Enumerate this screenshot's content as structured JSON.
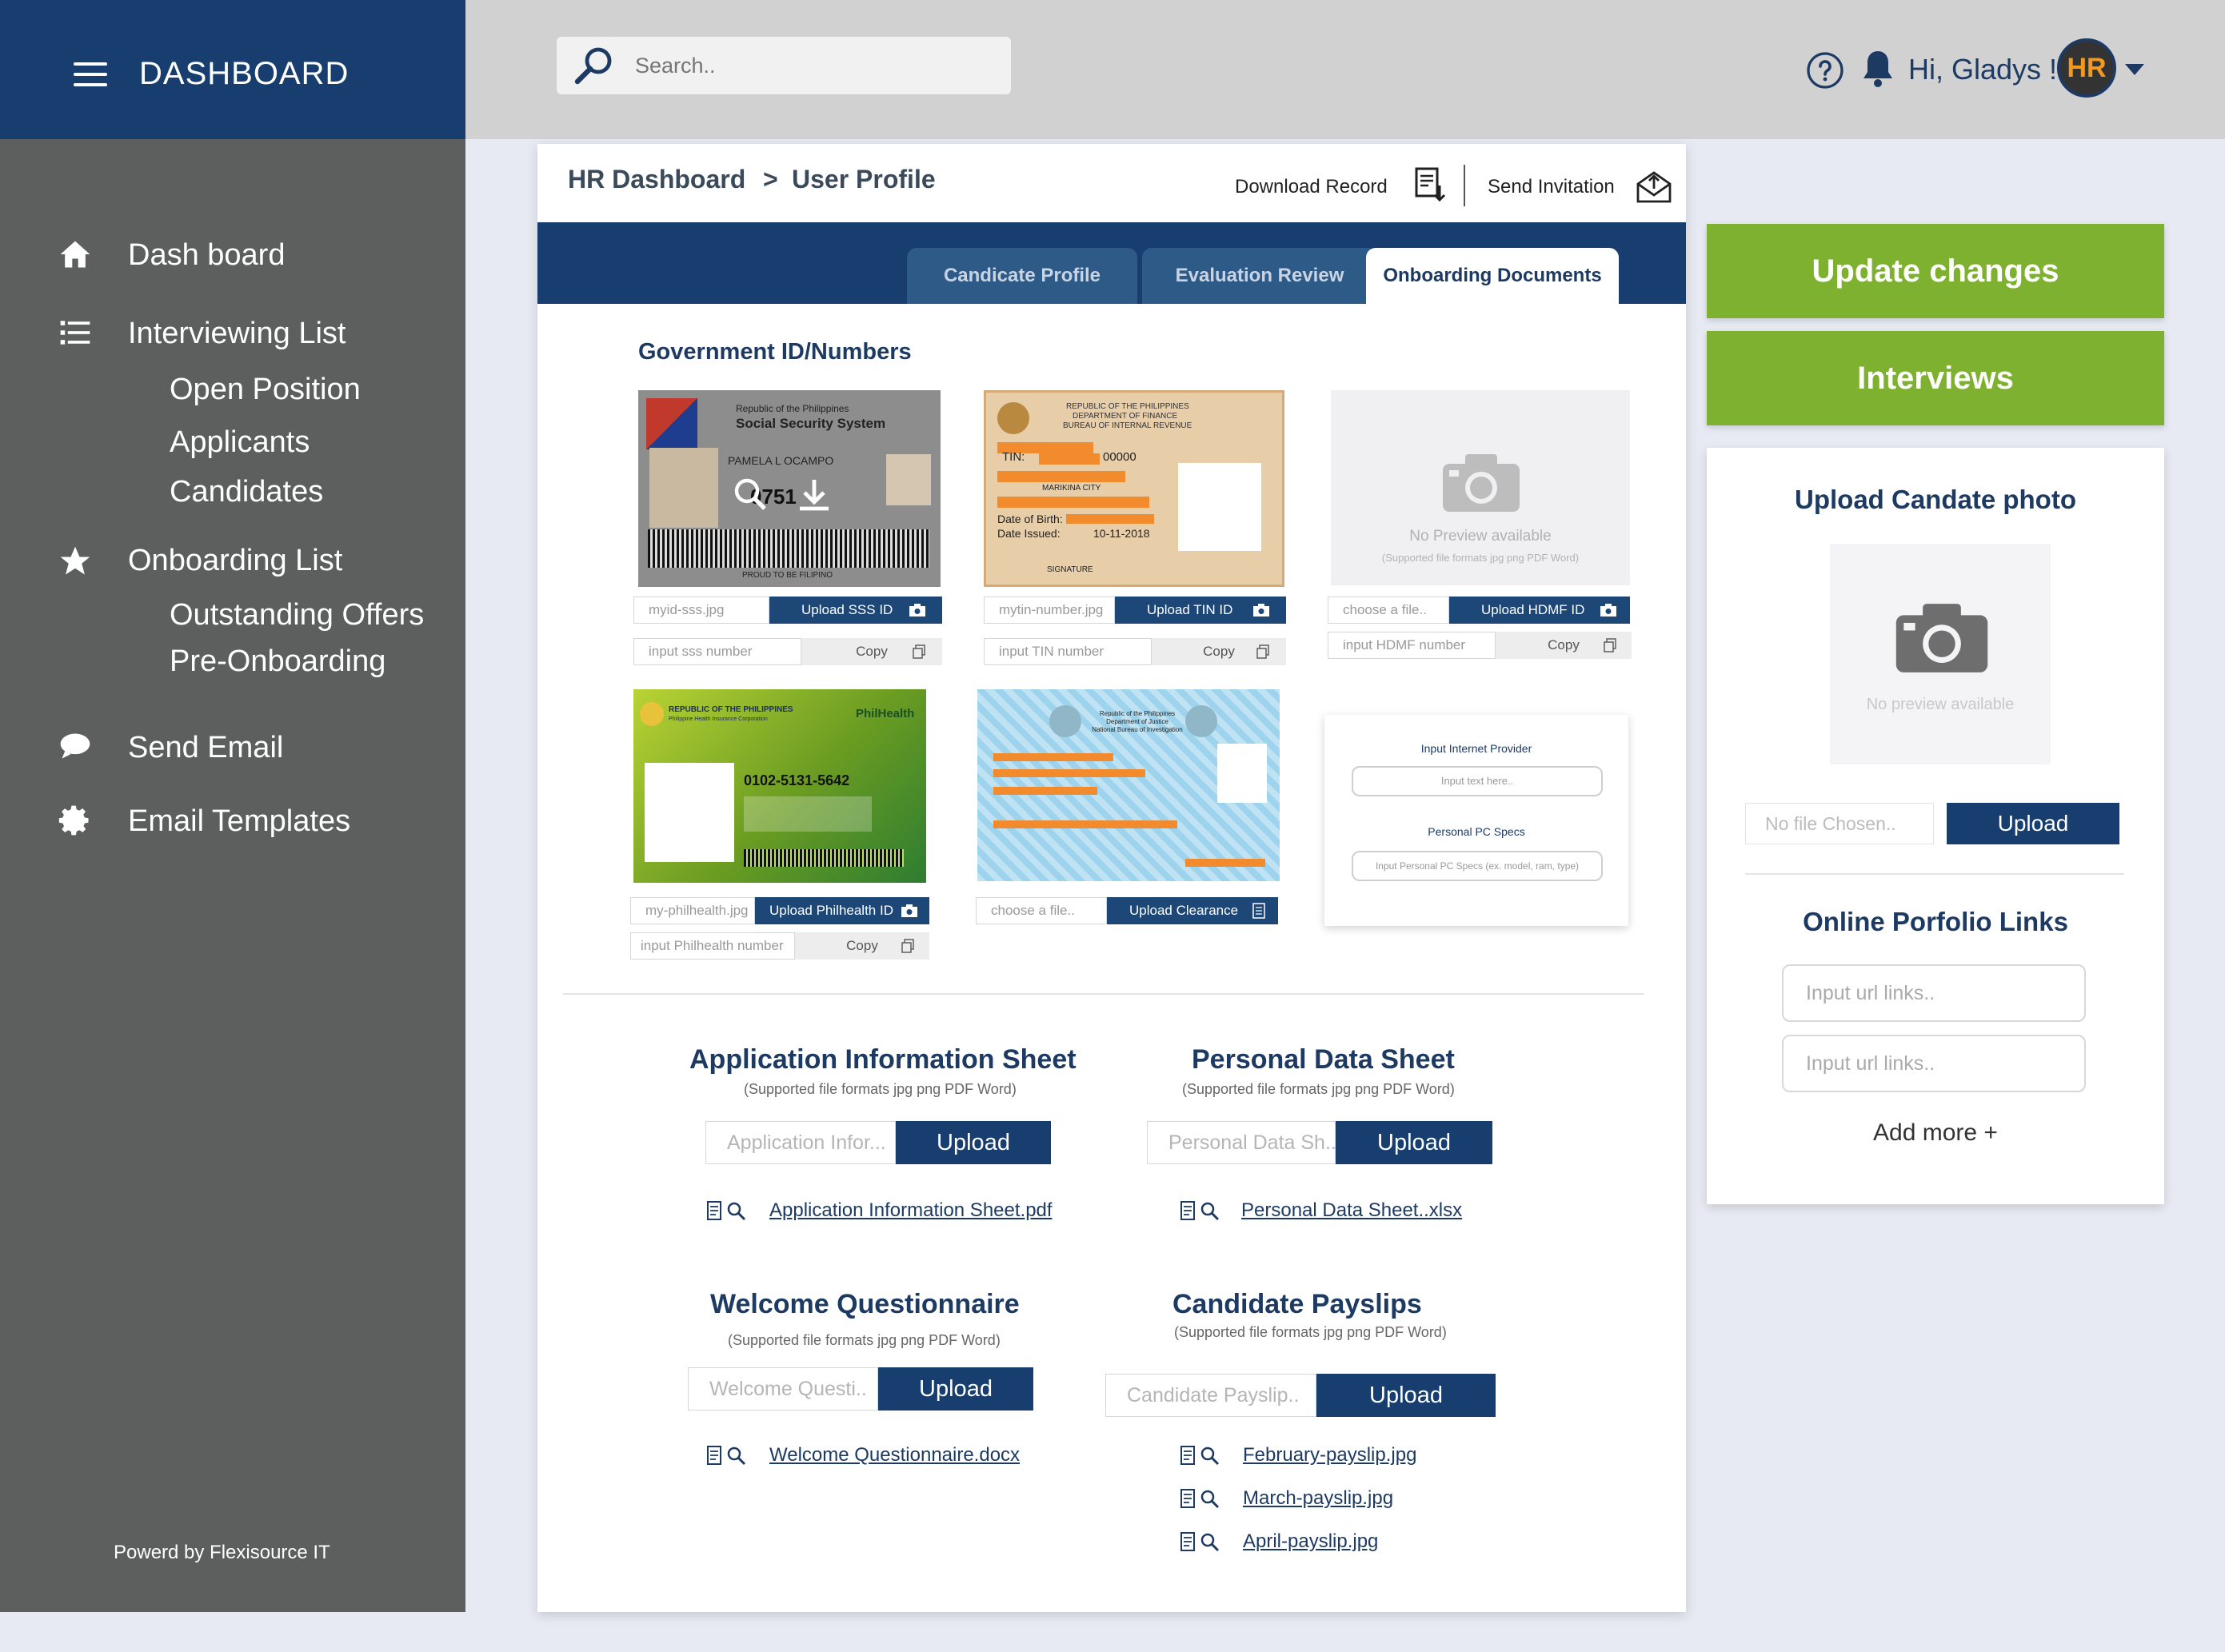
{
  "sidebar": {
    "title": "DASHBOARD",
    "items": [
      {
        "label": "Dash board"
      },
      {
        "label": "Interviewing List",
        "sub": [
          "Open Position",
          "Applicants",
          "Candidates"
        ]
      },
      {
        "label": "Onboarding List",
        "sub": [
          "Outstanding Offers",
          "Pre-Onboarding"
        ]
      },
      {
        "label": "Send Email"
      },
      {
        "label": "Email Templates"
      }
    ],
    "footer": "Powerd by Flexisource IT"
  },
  "topbar": {
    "search_placeholder": "Search..",
    "greeting": "Hi, Gladys !",
    "avatar_text": "HR"
  },
  "breadcrumb": {
    "root": "HR Dashboard",
    "separator": ">",
    "current": "User Profile"
  },
  "actions": {
    "download": "Download Record",
    "send": "Send Invitation"
  },
  "tabs": [
    {
      "label": "Candicate Profile",
      "active": false
    },
    {
      "label": "Evaluation Review",
      "active": false
    },
    {
      "label": "Onboarding Documents",
      "active": true
    }
  ],
  "gov": {
    "title": "Government ID/Numbers",
    "cards": [
      {
        "file": "myid-sss.jpg",
        "button": "Upload SSS ID",
        "number_placeholder": "input sss number",
        "copy": "Copy",
        "card_text": {
          "l1": "Republic of the Philippines",
          "l2": "Social Security System",
          "name": "PAMELA L OCAMPO",
          "num": "0751",
          "foot": "PROUD TO BE FILIPINO"
        }
      },
      {
        "file": "mytin-number.jpg",
        "button": "Upload TIN ID",
        "number_placeholder": "input TIN number",
        "copy": "Copy",
        "card_text": {
          "l1": "REPUBLIC OF THE PHILIPPINES",
          "l2": "DEPARTMENT OF FINANCE",
          "l3": "BUREAU OF INTERNAL REVENUE",
          "tin": "TIN:",
          "tin_num": "00000",
          "city": "MARIKINA CITY",
          "dob": "Date of Birth:",
          "issued": "Date Issued:",
          "issued_date": "10-11-2018",
          "sig": "SIGNATURE"
        }
      },
      {
        "file": "choose a file..",
        "button": "Upload HDMF ID",
        "number_placeholder": "input HDMF number",
        "copy": "Copy",
        "no_preview": "No Preview available",
        "formats": "(Supported file formats jpg png PDF Word)"
      },
      {
        "file": "my-philhealth.jpg",
        "button": "Upload Philhealth ID",
        "number_placeholder": "input Philhealth number",
        "copy": "Copy",
        "card_text": {
          "l1": "REPUBLIC OF THE PHILIPPINES",
          "l2": "Philippine Health Insurance Corporation",
          "brand": "PhilHealth",
          "num": "0102-5131-5642"
        }
      },
      {
        "file": "choose a file..",
        "button": "Upload Clearance",
        "card_text": {
          "l1": "Republic of the Philippines",
          "l2": "Department of Justice",
          "l3": "National Bureau of Investigation"
        }
      }
    ],
    "form": {
      "isp_label": "Input Internet Provider",
      "isp_placeholder": "Input text here..",
      "pc_label": "Personal PC Specs",
      "pc_placeholder": "Input Personal PC Specs (ex. model, ram, type)"
    }
  },
  "docs": [
    {
      "title": "Application Information Sheet",
      "formats": "(Supported file formats jpg png PDF Word)",
      "input": "Application Infor...",
      "button": "Upload",
      "files": [
        "Application Information Sheet.pdf"
      ]
    },
    {
      "title": "Personal Data Sheet",
      "formats": "(Supported file formats jpg png PDF Word)",
      "input": "Personal Data Sh..",
      "button": "Upload",
      "files": [
        "Personal Data Sheet..xlsx"
      ]
    },
    {
      "title": "Welcome Questionnaire",
      "formats": "(Supported file formats jpg png PDF Word)",
      "input": "Welcome Questi..",
      "button": "Upload",
      "files": [
        "Welcome Questionnaire.docx"
      ]
    },
    {
      "title": "Candidate Payslips",
      "formats": "(Supported file formats jpg png PDF Word)",
      "input": "Candidate Payslip..",
      "button": "Upload",
      "files": [
        "February-payslip.jpg",
        "March-payslip.jpg",
        "April-payslip.jpg"
      ]
    }
  ],
  "right": {
    "update": "Update changes",
    "interviews": "Interviews",
    "photo_title": "Upload Candate photo",
    "photo_nopreview": "No preview available",
    "photo_file": "No file Chosen..",
    "photo_upload": "Upload",
    "links_title": "Online Porfolio Links",
    "url_placeholders": [
      "Input url links..",
      "Input url links.."
    ],
    "add_more": "Add more +"
  },
  "colors": {
    "navy": "#173e6e",
    "green": "#7fb130",
    "sidebar": "#5d5e5e",
    "topbar": "#d1d1d1",
    "avatar_accent": "#f39a1e"
  }
}
